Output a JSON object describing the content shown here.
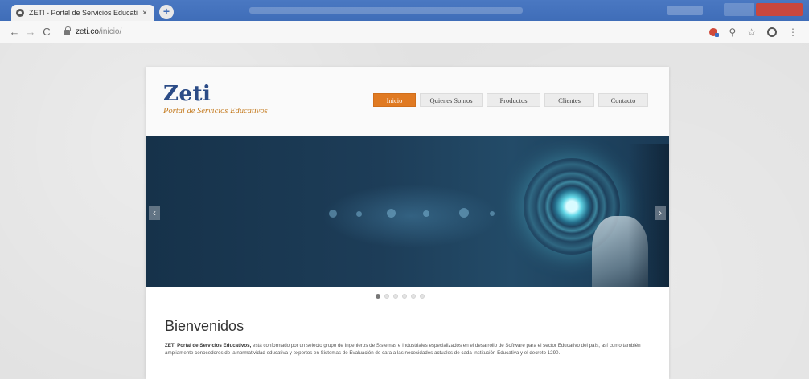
{
  "browser": {
    "tab_title": "ZETI - Portal de Servicios Educati",
    "tab_close": "×",
    "new_tab": "+",
    "url_host": "zeti.co",
    "url_path": "/inicio/",
    "back": "←",
    "forward": "→",
    "reload": "C",
    "search_glyph": "⚲",
    "star_glyph": "☆",
    "menu_glyph": "⋮"
  },
  "site": {
    "logo_name": "Zeti",
    "logo_tagline": "Portal de Servicios Educativos",
    "nav": [
      "Inicio",
      "Quienes Somos",
      "Productos",
      "Clientes",
      "Contacto"
    ],
    "active_nav": "Inicio",
    "slider": {
      "prev": "‹",
      "next": "›",
      "slide_count": 6,
      "active_slide": 1
    },
    "welcome": {
      "title": "Bienvenidos",
      "lead": "ZETI Portal de Servicios Educativos,",
      "body": " está conformado por un selecto grupo de Ingenieros de Sistemas e Industriales especializados en el desarrollo de Software para el sector Educativo del país, así como también ampliamente conocedores de la normatividad educativa y expertos en Sistemas de Evaluación de cara a las necesidades actuales de cada Institución Educativa y el decreto 1290."
    }
  },
  "colors": {
    "titlebar": "#3f6db8",
    "accent": "#e07a22",
    "logo_blue": "#2b4b86",
    "tagline_orange": "#c47a1e"
  }
}
